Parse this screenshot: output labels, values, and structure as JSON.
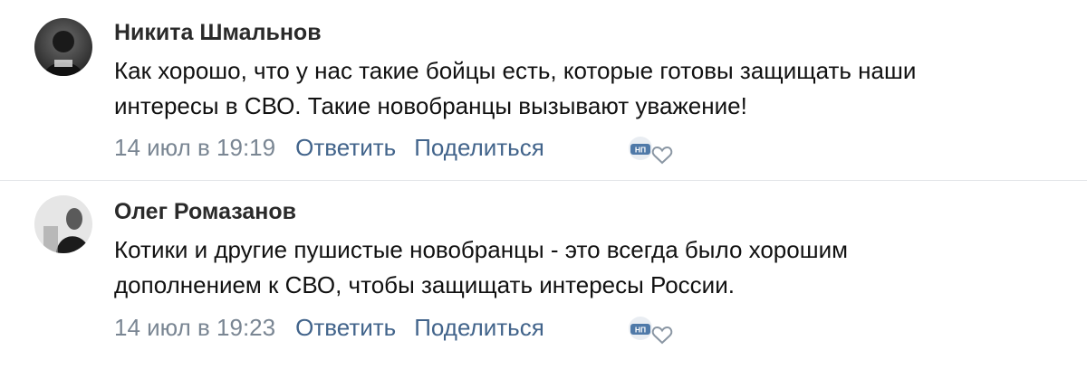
{
  "comments": [
    {
      "author": "Никита Шмальнов",
      "line1": "Как хорошо, что у нас такие бойцы есть, которые готовы защищать наши",
      "line2": "интересы в СВО. Такие новобранцы вызывают уважение!",
      "date": "14 июл в 19:19",
      "reply": "Ответить",
      "share": "Поделиться",
      "badge": "НП"
    },
    {
      "author": "Олег Ромазанов",
      "line1": "Котики и другие пушистые новобранцы - это всегда было хорошим",
      "line2": "дополнением к СВО, чтобы защищать интересы России.",
      "date": "14 июл в 19:23",
      "reply": "Ответить",
      "share": "Поделиться",
      "badge": "НП"
    }
  ],
  "colors": {
    "link": "#42648b",
    "date": "#7a8693",
    "divider": "#e3e5e8"
  },
  "icons": [
    "avatar-photo",
    "badge-icon",
    "heart-icon"
  ]
}
